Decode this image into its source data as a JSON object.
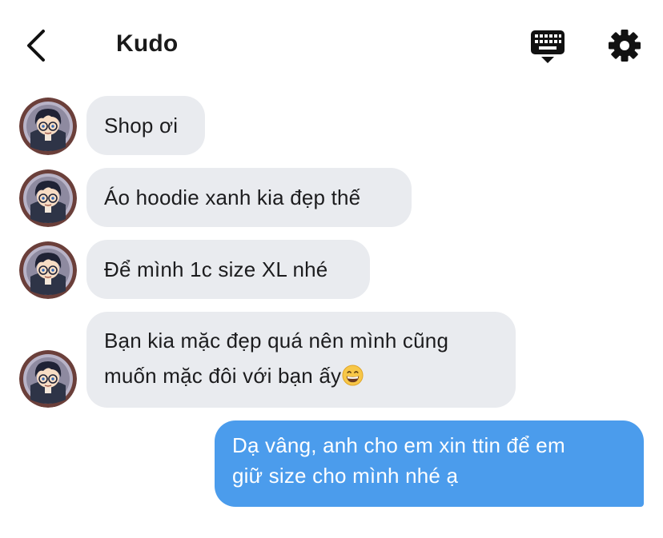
{
  "header": {
    "title": "Kudo",
    "back_icon": "chevron-left-icon",
    "keyboard_icon": "keyboard-icon",
    "settings_icon": "gear-icon"
  },
  "messages": [
    {
      "direction": "incoming",
      "lines": [
        " Shop ơi"
      ]
    },
    {
      "direction": "incoming",
      "lines": [
        "Áo hoodie xanh kia đẹp thế"
      ]
    },
    {
      "direction": "incoming",
      "lines": [
        "Để mình 1c size XL nhé"
      ]
    },
    {
      "direction": "incoming",
      "lines": [
        "Bạn kia mặc đẹp quá nên mình cũng",
        "muốn mặc đôi với bạn ấy"
      ],
      "emoji": "grinning-face-icon"
    },
    {
      "direction": "outgoing",
      "lines": [
        "Dạ vâng, anh cho em xin ttin để em",
        "giữ size cho mình nhé ạ"
      ]
    }
  ],
  "colors": {
    "incoming_bubble": "#e9ebef",
    "outgoing_bubble": "#4b9cec",
    "avatar_ring": "#6b3f3a"
  }
}
